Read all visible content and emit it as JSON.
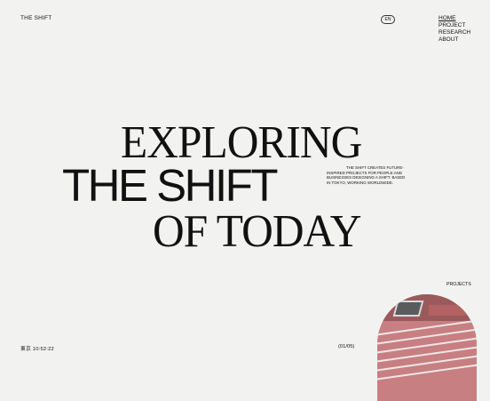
{
  "header": {
    "logo": "THE SHIFT",
    "language": "EN",
    "nav": [
      "HOME",
      "PROJECT",
      "RESEARCH",
      "ABOUT"
    ]
  },
  "hero": {
    "line1": "EXPLORING",
    "line2": "THE SHIFT",
    "line3": "OF TODAY"
  },
  "blurb": "THE SHIFT CREATES FUTURE-INSPIRED PROJECTS FOR PEOPLE AND BUSINESSES DESIGNING A SHIFT. BASED IN TOKYO, WORKING WORLDWIDE.",
  "projects": {
    "label": "PROJECTS",
    "counter": "(01/05)"
  },
  "footer": {
    "time": "東京 10:52:22"
  },
  "colors": {
    "background": "#f2f2f1",
    "text": "#111111",
    "preview_accent": "#c77f82"
  }
}
